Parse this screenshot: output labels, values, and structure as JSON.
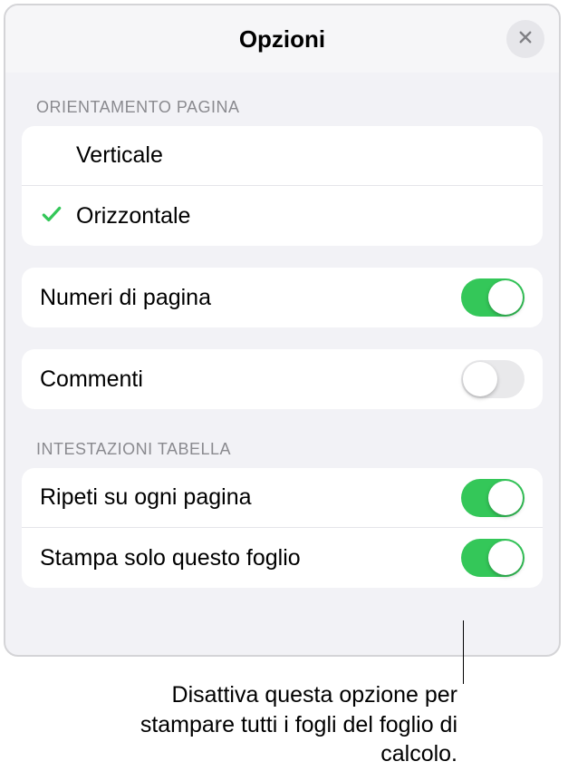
{
  "header": {
    "title": "Opzioni"
  },
  "orientation": {
    "section_label": "ORIENTAMENTO PAGINA",
    "options": [
      {
        "label": "Verticale",
        "selected": false
      },
      {
        "label": "Orizzontale",
        "selected": true
      }
    ]
  },
  "page_numbers": {
    "label": "Numeri di pagina",
    "on": true
  },
  "comments": {
    "label": "Commenti",
    "on": false
  },
  "table_headers": {
    "section_label": "INTESTAZIONI TABELLA",
    "repeat": {
      "label": "Ripeti su ogni pagina",
      "on": true
    },
    "print_only": {
      "label": "Stampa solo questo foglio",
      "on": true
    }
  },
  "callout": {
    "text": "Disattiva questa opzione per stampare tutti i fogli del foglio di calcolo."
  },
  "colors": {
    "accent": "#34c759"
  }
}
